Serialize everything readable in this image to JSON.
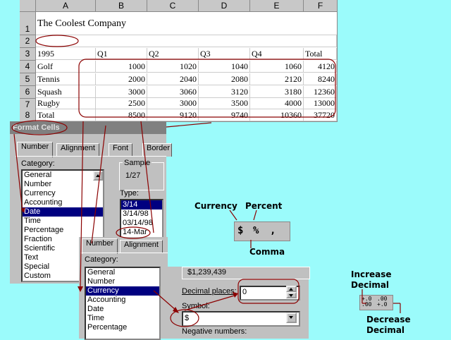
{
  "spreadsheet": {
    "col_headers": [
      "A",
      "B",
      "C",
      "D",
      "E",
      "F"
    ],
    "row_headers": [
      "1",
      "2",
      "3",
      "4",
      "5",
      "6",
      "7",
      "8"
    ],
    "title": "The Coolest Company",
    "header_row": [
      "1995",
      "Q1",
      "Q2",
      "Q3",
      "Q4",
      "Total"
    ],
    "rows": [
      {
        "label": "Golf",
        "values": [
          "1000",
          "1020",
          "1040",
          "1060",
          "4120"
        ]
      },
      {
        "label": "Tennis",
        "values": [
          "2000",
          "2040",
          "2080",
          "2120",
          "8240"
        ]
      },
      {
        "label": "Squash",
        "values": [
          "3000",
          "3060",
          "3120",
          "3180",
          "12360"
        ]
      },
      {
        "label": "Rugby",
        "values": [
          "2500",
          "3000",
          "3500",
          "4000",
          "13000"
        ]
      },
      {
        "label": "Total",
        "values": [
          "8500",
          "9120",
          "9740",
          "10360",
          "37720"
        ]
      }
    ]
  },
  "format_dialog": {
    "title": "Format Cells",
    "tabs": [
      "Number",
      "Alignment",
      "Font",
      "Border"
    ],
    "category_label": "Category:",
    "categories": [
      "General",
      "Number",
      "Currency",
      "Accounting",
      "Date",
      "Time",
      "Percentage",
      "Fraction",
      "Scientific",
      "Text",
      "Special",
      "Custom"
    ],
    "selected_category": "Date",
    "sample_label": "Sample",
    "sample_value": "1/27",
    "type_label": "Type:",
    "types": [
      "3/14",
      "3/14/98",
      "03/14/98",
      "14-Mar"
    ],
    "selected_type": "3/14"
  },
  "currency_dialog": {
    "tabs": [
      "Number",
      "Alignment"
    ],
    "category_label": "Category:",
    "categories": [
      "General",
      "Number",
      "Currency",
      "Accounting",
      "Date",
      "Time",
      "Percentage"
    ],
    "selected_category": "Currency",
    "sample_value": "$1,239,439",
    "decimal_label": "Decimal places:",
    "decimal_value": "0",
    "symbol_label": "Symbol:",
    "symbol_value": "$",
    "negative_label": "Negative numbers:"
  },
  "toolbar_callouts": {
    "currency_label": "Currency",
    "percent_label": "Percent",
    "comma_label": "Comma",
    "currency_glyph": "$",
    "percent_glyph": "%",
    "comma_glyph": ",",
    "increase_label_1": "Increase",
    "increase_label_2": "Decimal",
    "decrease_label_1": "Decrease",
    "decrease_label_2": "Decimal",
    "increase_glyph_top": "+.0",
    "increase_glyph_bottom": ".00",
    "decrease_glyph_top": ".00",
    "decrease_glyph_bottom": "+.0"
  },
  "colors": {
    "background": "#9bfbfb",
    "annotation": "#8b0000",
    "selection": "#000080"
  }
}
